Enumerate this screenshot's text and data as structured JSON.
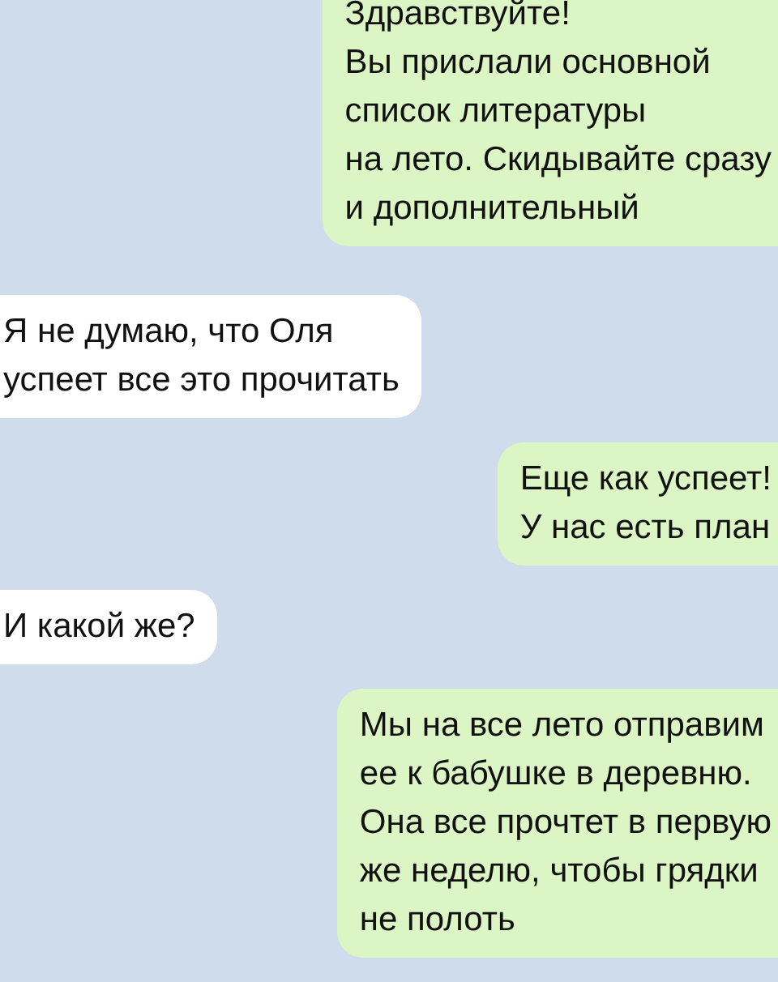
{
  "messages": [
    {
      "kind": "outgoing",
      "text": "Здравствуйте!\nВы прислали основной\nсписок литературы\nна лето. Скидывайте сразу\nи дополнительный"
    },
    {
      "kind": "incoming",
      "text": "Я не думаю, что Оля\nуспеет все это прочитать"
    },
    {
      "kind": "outgoing",
      "text": "Еще как успеет!\nУ нас есть план"
    },
    {
      "kind": "incoming",
      "text": "И какой же?"
    },
    {
      "kind": "outgoing",
      "text": "Мы на все лето отправим\nее к бабушке в деревню.\nОна все прочтет в первую\nже неделю, чтобы грядки\nне полоть"
    }
  ]
}
